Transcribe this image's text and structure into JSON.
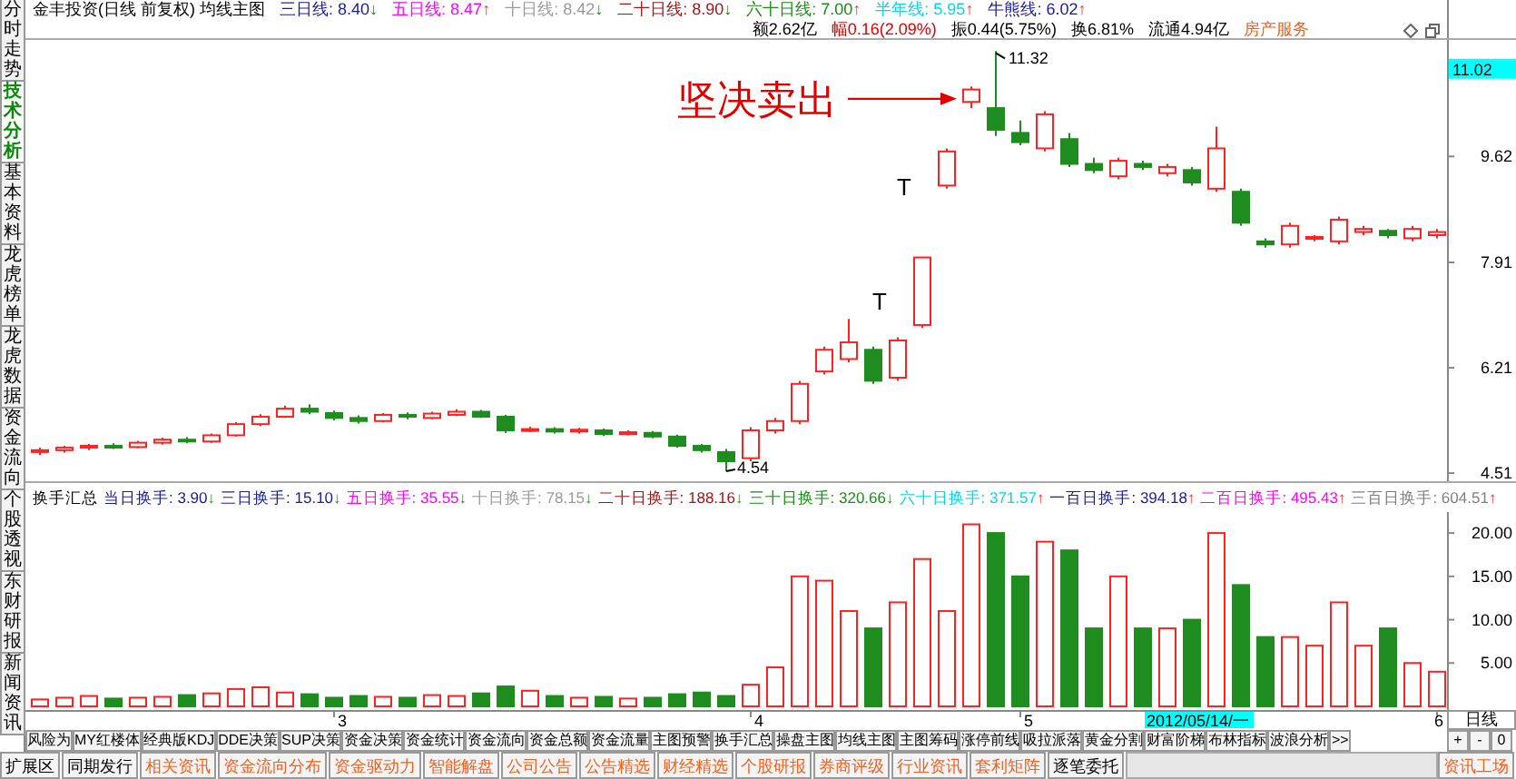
{
  "side_tabs": [
    {
      "label": "分时走势",
      "selected": false
    },
    {
      "label": "技术分析",
      "selected": true
    },
    {
      "label": "基本资料",
      "selected": false
    },
    {
      "label": "龙虎榜单",
      "selected": false
    },
    {
      "label": "龙虎数据",
      "selected": false
    },
    {
      "label": "资金流向",
      "selected": false
    },
    {
      "label": "个股透视",
      "selected": false
    },
    {
      "label": "东财研报",
      "selected": false
    },
    {
      "label": "新闻资讯",
      "selected": false
    }
  ],
  "header": {
    "title": "金丰投资(日线 前复权) 均线主图",
    "averages": [
      {
        "label": "三日线: 8.40",
        "arrow": "↓",
        "rising": false,
        "color": "#1a1a9a"
      },
      {
        "label": "五日线: 8.47",
        "arrow": "↑",
        "rising": true,
        "color": "#ff00ff"
      },
      {
        "label": "十日线: 8.42",
        "arrow": "↓",
        "rising": false,
        "color": "#9a9a9a"
      },
      {
        "label": "二十日线: 8.90",
        "arrow": "↓",
        "rising": false,
        "color": "#a01818"
      },
      {
        "label": "六十日线: 7.00",
        "arrow": "↑",
        "rising": true,
        "color": "#188c18"
      },
      {
        "label": "半年线: 5.95",
        "arrow": "↑",
        "rising": true,
        "color": "#00d8e8"
      },
      {
        "label": "牛熊线: 6.02",
        "arrow": "↑",
        "rising": true,
        "color": "#1a1a9a"
      }
    ],
    "quotes": [
      {
        "text": "额2.62亿",
        "color": "#000000"
      },
      {
        "text": "幅0.16(2.09%)",
        "color": "#e00000"
      },
      {
        "text": "振0.44(5.75%)",
        "color": "#000000"
      },
      {
        "text": "换6.81%",
        "color": "#000000"
      },
      {
        "text": "流通4.94亿",
        "color": "#000000"
      },
      {
        "text": "房产服务",
        "color": "#f06020"
      }
    ]
  },
  "price_chart": {
    "axis_labels": [
      "9.62",
      "7.91",
      "6.21",
      "4.51"
    ],
    "current_price": "11.02",
    "high_label": "11.32",
    "low_label": "4.54",
    "marks": [
      "T",
      "T"
    ],
    "annotation": "坚决卖出"
  },
  "volume_header": {
    "title": "换手汇总",
    "items": [
      {
        "label": "当日换手: 3.90",
        "arrow": "↓",
        "rising": false,
        "color": "#1a1a9a"
      },
      {
        "label": "三日换手: 15.10",
        "arrow": "↓",
        "rising": false,
        "color": "#1a1a9a"
      },
      {
        "label": "五日换手: 35.55",
        "arrow": "↓",
        "rising": false,
        "color": "#ff00ff"
      },
      {
        "label": "十日换手: 78.15",
        "arrow": "↓",
        "rising": false,
        "color": "#9a9a9a"
      },
      {
        "label": "二十日换手: 188.16",
        "arrow": "↓",
        "rising": false,
        "color": "#a01818"
      },
      {
        "label": "三十日换手: 320.66",
        "arrow": "↓",
        "rising": false,
        "color": "#188c18"
      },
      {
        "label": "六十日换手: 371.57",
        "arrow": "↑",
        "rising": true,
        "color": "#00d8e8"
      },
      {
        "label": "一百日换手: 394.18",
        "arrow": "↑",
        "rising": true,
        "color": "#1a1a9a"
      },
      {
        "label": "二百日换手: 495.43",
        "arrow": "↑",
        "rising": true,
        "color": "#ff00ff"
      },
      {
        "label": "三百日换手: 604.51",
        "arrow": "↑",
        "rising": true,
        "color": "#808080"
      }
    ]
  },
  "volume_chart": {
    "axis_labels": [
      "20.00",
      "15.00",
      "10.00",
      "5.00"
    ]
  },
  "time_axis": {
    "labels": [
      "3",
      "4",
      "5",
      "6"
    ],
    "cursor_date": "2012/05/14/一"
  },
  "period_label": "日线",
  "toolbar": [
    {
      "label": "风险为"
    },
    {
      "label": "MY红楼体"
    },
    {
      "label": "经典版KDJ"
    },
    {
      "label": "DDE决策"
    },
    {
      "label": "SUP决策"
    },
    {
      "label": "资金决策"
    },
    {
      "label": "资金统计"
    },
    {
      "label": "资金流向"
    },
    {
      "label": "资金总额"
    },
    {
      "label": "资金流量"
    },
    {
      "label": "主图预警"
    },
    {
      "label": "换手汇总"
    },
    {
      "label": "操盘主图"
    },
    {
      "label": "均线主图"
    },
    {
      "label": "主图筹码"
    },
    {
      "label": "涨停前线"
    },
    {
      "label": "吸拉派落"
    },
    {
      "label": "黄金分割"
    },
    {
      "label": "财富阶梯"
    },
    {
      "label": "布林指标"
    },
    {
      "label": "波浪分析"
    },
    {
      "label": ">>"
    }
  ],
  "zoom_buttons": [
    "+",
    "-",
    "0"
  ],
  "info_tabs": [
    {
      "label": "扩展区",
      "color": "#000000"
    },
    {
      "label": "同期发行",
      "color": "#000000"
    },
    {
      "label": "相关资讯",
      "color": "#f06020"
    },
    {
      "label": "资金流向分布",
      "color": "#f06020"
    },
    {
      "label": "资金驱动力",
      "color": "#f06020"
    },
    {
      "label": "智能解盘",
      "color": "#f06020"
    },
    {
      "label": "公司公告",
      "color": "#f06020"
    },
    {
      "label": "公告精选",
      "color": "#f06020"
    },
    {
      "label": "财经精选",
      "color": "#f06020"
    },
    {
      "label": "个股研报",
      "color": "#f06020"
    },
    {
      "label": "券商评级",
      "color": "#f06020"
    },
    {
      "label": "行业资讯",
      "color": "#f06020"
    },
    {
      "label": "套利矩阵",
      "color": "#f06020"
    },
    {
      "label": "逐笔委托",
      "color": "#000000"
    }
  ],
  "info_corner": {
    "label": "资讯工场",
    "color": "#f06020"
  }
}
